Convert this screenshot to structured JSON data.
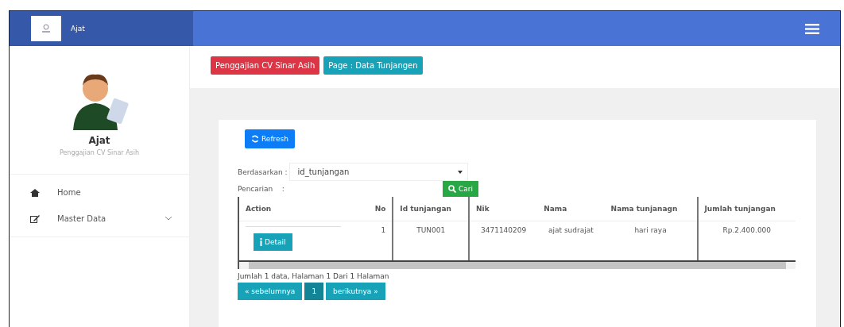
{
  "header": {
    "brand": "Ajat"
  },
  "profile": {
    "name": "Ajat",
    "subtitle": "Penggajian CV Sinar Asih"
  },
  "menu": [
    {
      "label": "Home",
      "kind": "home",
      "expandable": false
    },
    {
      "label": "Master Data",
      "kind": "edit",
      "expandable": true
    }
  ],
  "breadcrumb": [
    "Penggajian CV Sinar Asih",
    "Page : Data Tunjangen"
  ],
  "refresh_button": "Refresh",
  "filter": {
    "label": "Berdasarkan :",
    "value": "id_tunjangan"
  },
  "search": {
    "label": "Pencarian    :",
    "button": "Cari"
  },
  "table": {
    "columns": [
      "Action",
      "No",
      "Id tunjangan",
      "Nik",
      "Nama",
      "Nama tunjanagn",
      "Jumlah tunjangan"
    ],
    "rows": [
      {
        "cells": [
          "Detail",
          "1",
          "TUN001",
          "3471140209",
          "ajat sudrajat",
          "hari raya",
          "Rp.2.400.000"
        ]
      }
    ]
  },
  "summary": "Jumlah 1 data, Halaman 1 Dari 1 Halaman",
  "pagination": [
    {
      "label": "« sebelumnya",
      "selected": false
    },
    {
      "label": "1",
      "selected": true
    },
    {
      "label": "berikutnya »",
      "selected": false
    }
  ]
}
